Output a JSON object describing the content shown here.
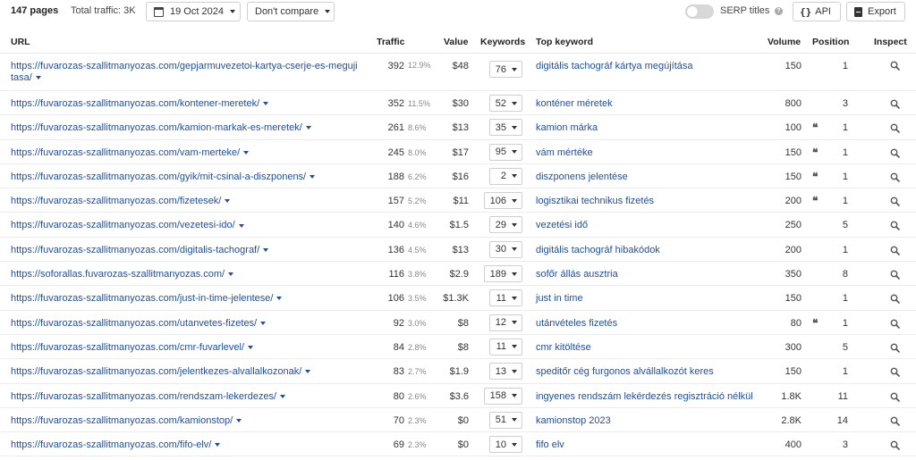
{
  "toolbar": {
    "pages": "147 pages",
    "total_traffic": "Total traffic: 3K",
    "date": "19 Oct 2024",
    "compare": "Don't compare",
    "serp_titles": "SERP titles",
    "serp_help": "?",
    "api_braces": "{}",
    "api": "API",
    "export": "Export"
  },
  "columns": {
    "url": "URL",
    "traffic": "Traffic",
    "value": "Value",
    "keywords": "Keywords",
    "top_keyword": "Top keyword",
    "volume": "Volume",
    "position": "Position",
    "inspect": "Inspect"
  },
  "rows": [
    {
      "url": "https://fuvarozas-szallitmanyozas.com/gepjarmuvezetoi-kartya-cserje-es-meguji tasa/",
      "traffic": "392",
      "pct": "12.9%",
      "value": "$48",
      "keywords": "76",
      "top_keyword": "digitális tachográf kártya megújítása",
      "volume": "150",
      "quote": "",
      "position": "1"
    },
    {
      "url": "https://fuvarozas-szallitmanyozas.com/kontener-meretek/",
      "traffic": "352",
      "pct": "11.5%",
      "value": "$30",
      "keywords": "52",
      "top_keyword": "konténer méretek",
      "volume": "800",
      "quote": "",
      "position": "3"
    },
    {
      "url": "https://fuvarozas-szallitmanyozas.com/kamion-markak-es-meretek/",
      "traffic": "261",
      "pct": "8.6%",
      "value": "$13",
      "keywords": "35",
      "top_keyword": "kamion márka",
      "volume": "100",
      "quote": "❝",
      "position": "1"
    },
    {
      "url": "https://fuvarozas-szallitmanyozas.com/vam-merteke/",
      "traffic": "245",
      "pct": "8.0%",
      "value": "$17",
      "keywords": "95",
      "top_keyword": "vám mértéke",
      "volume": "150",
      "quote": "❝",
      "position": "1"
    },
    {
      "url": "https://fuvarozas-szallitmanyozas.com/gyik/mit-csinal-a-diszponens/",
      "traffic": "188",
      "pct": "6.2%",
      "value": "$16",
      "keywords": "2",
      "top_keyword": "diszponens jelentése",
      "volume": "150",
      "quote": "❝",
      "position": "1"
    },
    {
      "url": "https://fuvarozas-szallitmanyozas.com/fizetesek/",
      "traffic": "157",
      "pct": "5.2%",
      "value": "$11",
      "keywords": "106",
      "top_keyword": "logisztikai technikus fizetés",
      "volume": "200",
      "quote": "❝",
      "position": "1"
    },
    {
      "url": "https://fuvarozas-szallitmanyozas.com/vezetesi-ido/",
      "traffic": "140",
      "pct": "4.6%",
      "value": "$1.5",
      "keywords": "29",
      "top_keyword": "vezetési idő",
      "volume": "250",
      "quote": "",
      "position": "5"
    },
    {
      "url": "https://fuvarozas-szallitmanyozas.com/digitalis-tachograf/",
      "traffic": "136",
      "pct": "4.5%",
      "value": "$13",
      "keywords": "30",
      "top_keyword": "digitális tachográf hibakódok",
      "volume": "200",
      "quote": "",
      "position": "1"
    },
    {
      "url": "https://soforallas.fuvarozas-szallitmanyozas.com/",
      "traffic": "116",
      "pct": "3.8%",
      "value": "$2.9",
      "keywords": "189",
      "top_keyword": "sofőr állás ausztria",
      "volume": "350",
      "quote": "",
      "position": "8"
    },
    {
      "url": "https://fuvarozas-szallitmanyozas.com/just-in-time-jelentese/",
      "traffic": "106",
      "pct": "3.5%",
      "value": "$1.3K",
      "keywords": "11",
      "top_keyword": "just in time",
      "volume": "150",
      "quote": "",
      "position": "1"
    },
    {
      "url": "https://fuvarozas-szallitmanyozas.com/utanvetes-fizetes/",
      "traffic": "92",
      "pct": "3.0%",
      "value": "$8",
      "keywords": "12",
      "top_keyword": "utánvételes fizetés",
      "volume": "80",
      "quote": "❝",
      "position": "1"
    },
    {
      "url": "https://fuvarozas-szallitmanyozas.com/cmr-fuvarlevel/",
      "traffic": "84",
      "pct": "2.8%",
      "value": "$8",
      "keywords": "11",
      "top_keyword": "cmr kitöltése",
      "volume": "300",
      "quote": "",
      "position": "5"
    },
    {
      "url": "https://fuvarozas-szallitmanyozas.com/jelentkezes-alvallalkozonak/",
      "traffic": "83",
      "pct": "2.7%",
      "value": "$1.9",
      "keywords": "13",
      "top_keyword": "speditőr cég furgonos alvállalkozót keres",
      "volume": "150",
      "quote": "",
      "position": "1"
    },
    {
      "url": "https://fuvarozas-szallitmanyozas.com/rendszam-lekerdezes/",
      "traffic": "80",
      "pct": "2.6%",
      "value": "$3.6",
      "keywords": "158",
      "top_keyword": "ingyenes rendszám lekérdezés regisztráció nélkül",
      "volume": "1.8K",
      "quote": "",
      "position": "11"
    },
    {
      "url": "https://fuvarozas-szallitmanyozas.com/kamionstop/",
      "traffic": "70",
      "pct": "2.3%",
      "value": "$0",
      "keywords": "51",
      "top_keyword": "kamionstop 2023",
      "volume": "2.8K",
      "quote": "",
      "position": "14"
    },
    {
      "url": "https://fuvarozas-szallitmanyozas.com/fifo-elv/",
      "traffic": "69",
      "pct": "2.3%",
      "value": "$0",
      "keywords": "10",
      "top_keyword": "fifo elv",
      "volume": "400",
      "quote": "",
      "position": "3"
    }
  ]
}
